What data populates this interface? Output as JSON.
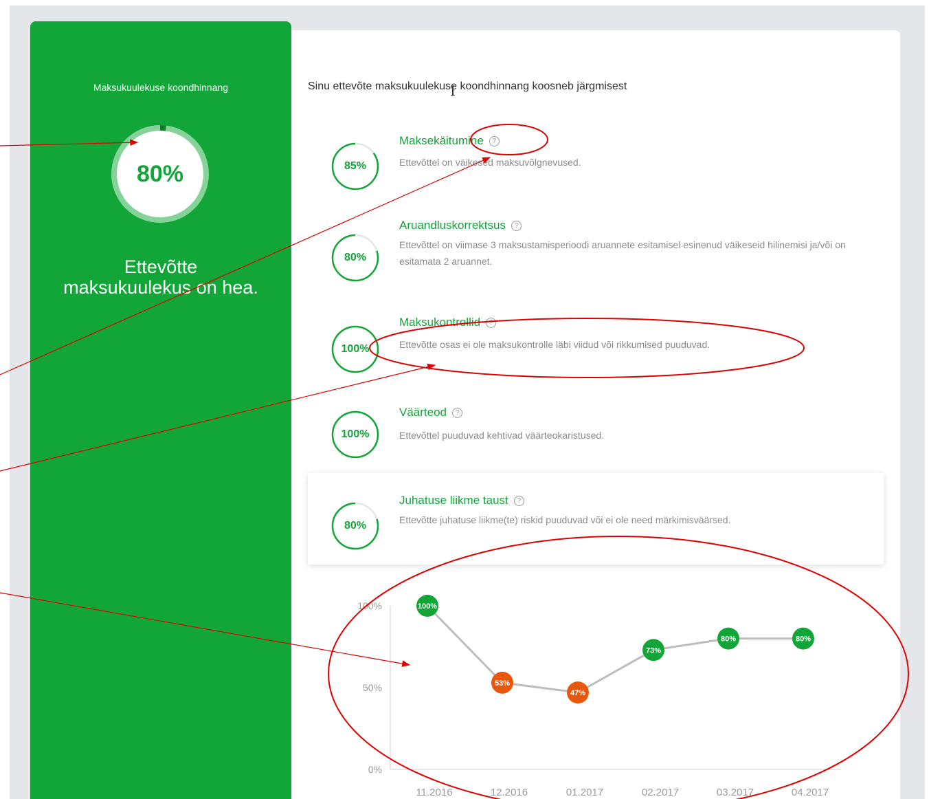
{
  "sidebar": {
    "title": "Maksukuulekuse koondhinnang",
    "score_label": "80%",
    "score_fraction": 0.8,
    "status_text": "Ettevõtte maksukuulekus on hea.",
    "bg_color": "#12a538"
  },
  "main": {
    "intro": "Sinu ettevõte maksukuulekuse koondhinnang koosneb järgmisest",
    "help_icon": "question-circle-icon",
    "items": [
      {
        "pct": "85%",
        "fraction": 0.85,
        "title": "Maksekäitumine",
        "desc": "Ettevõttel on väikesed maksuvõlgnevused."
      },
      {
        "pct": "80%",
        "fraction": 0.8,
        "title": "Aruandluskorrektsus",
        "desc": "Ettevõttel on viimase 3 maksustamisperioodi aruannete esitamisel esinenud väikeseid hilinemisi ja/või on esitamata 2 aruannet."
      },
      {
        "pct": "100%",
        "fraction": 1.0,
        "title": "Maksukontrollid",
        "desc": "Ettevõtte osas ei ole maksukontrolle läbi viidud või rikkumised puuduvad."
      },
      {
        "pct": "100%",
        "fraction": 1.0,
        "title": "Väärteod",
        "desc": "Ettevõttel puuduvad kehtivad väärteokaristused."
      },
      {
        "pct": "80%",
        "fraction": 0.8,
        "title": "Juhatuse liikme taust",
        "desc": "Ettevõtte juhatuse liikme(te) riskid puuduvad või ei ole need märkimisväärsed."
      }
    ]
  },
  "chart_data": {
    "type": "line",
    "categories": [
      "11.2016",
      "12.2016",
      "01.2017",
      "02.2017",
      "03.2017",
      "04.2017"
    ],
    "values": [
      100,
      53,
      47,
      73,
      80,
      80
    ],
    "value_labels": [
      "100%",
      "53%",
      "47%",
      "73%",
      "80%",
      "80%"
    ],
    "y_ticks": [
      "100%",
      "50%",
      "0%"
    ],
    "ylim": [
      0,
      100
    ],
    "grid": false,
    "colors": {
      "good": "#12a538",
      "bad": "#e8580c",
      "line": "#bdbdbd"
    }
  },
  "annotation_color": "#e00000"
}
